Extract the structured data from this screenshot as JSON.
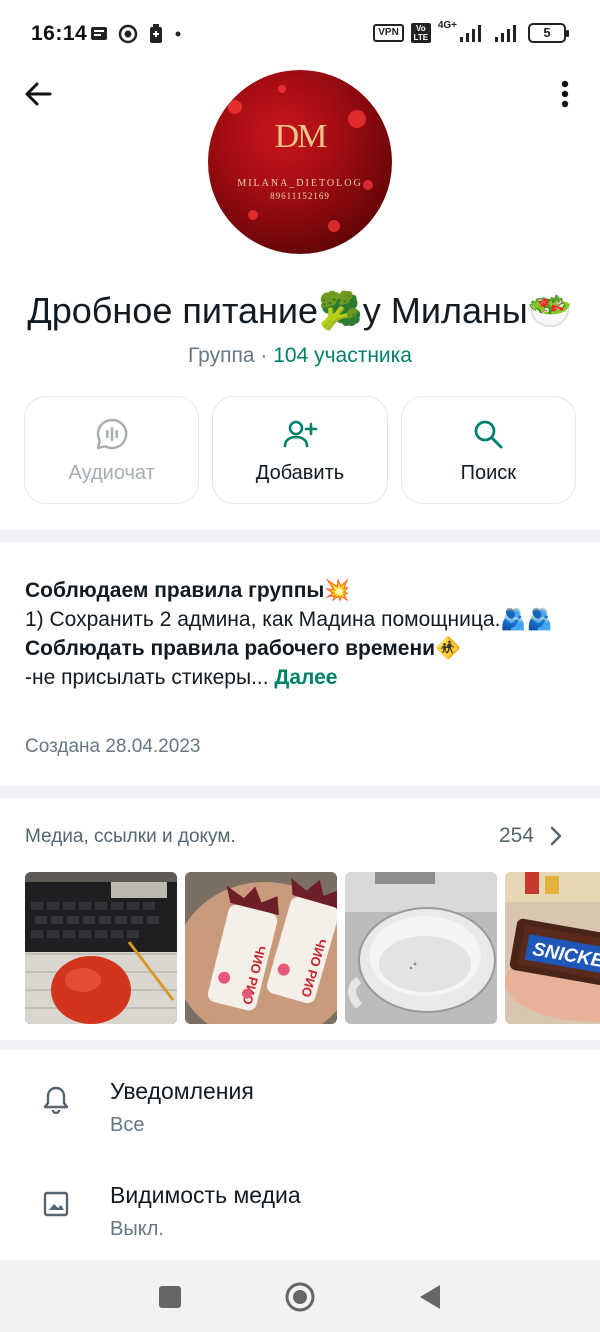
{
  "status_bar": {
    "time": "16:14",
    "vpn": "VPN",
    "volte": "Vo LTE",
    "network": "4G+",
    "battery": "5"
  },
  "header": {
    "avatar": {
      "monogram": "DM",
      "name": "MILANA_DIETOLOG",
      "phone": "89611152169"
    }
  },
  "group": {
    "title": "Дробное питание🥦у Миланы🥗",
    "type": "Группа · ",
    "members": "104 участника"
  },
  "actions": [
    {
      "label": "Аудиочат",
      "icon": "audio-chat-icon",
      "enabled": false
    },
    {
      "label": "Добавить",
      "icon": "add-person-icon",
      "enabled": true
    },
    {
      "label": "Поиск",
      "icon": "search-icon",
      "enabled": true
    }
  ],
  "description": {
    "line1": "Соблюдаем правила группы💥",
    "line2": "1) Сохранить 2 админа, как Мадина помощница.🫂🫂",
    "line3": "Соблюдать правила рабочего времени🚸",
    "line4": "-не присылать стикеры... ",
    "more": "Далее",
    "created": "Создана 28.04.2023"
  },
  "media": {
    "title": "Медиа, ссылки и докум.",
    "count": "254",
    "thumbnails": [
      "persimmon-photo",
      "candy-photo",
      "cup-photo",
      "snickers-photo"
    ],
    "thumb_text": {
      "candy": "ЧИО РИО",
      "snickers": "SNICKERS"
    }
  },
  "settings": [
    {
      "title": "Уведомления",
      "value": "Все",
      "icon": "bell-icon"
    },
    {
      "title": "Видимость медиа",
      "value": "Выкл.",
      "icon": "image-icon"
    }
  ],
  "colors": {
    "accent": "#008069",
    "secondary_text": "#667781",
    "divider": "#f0f2f5"
  }
}
